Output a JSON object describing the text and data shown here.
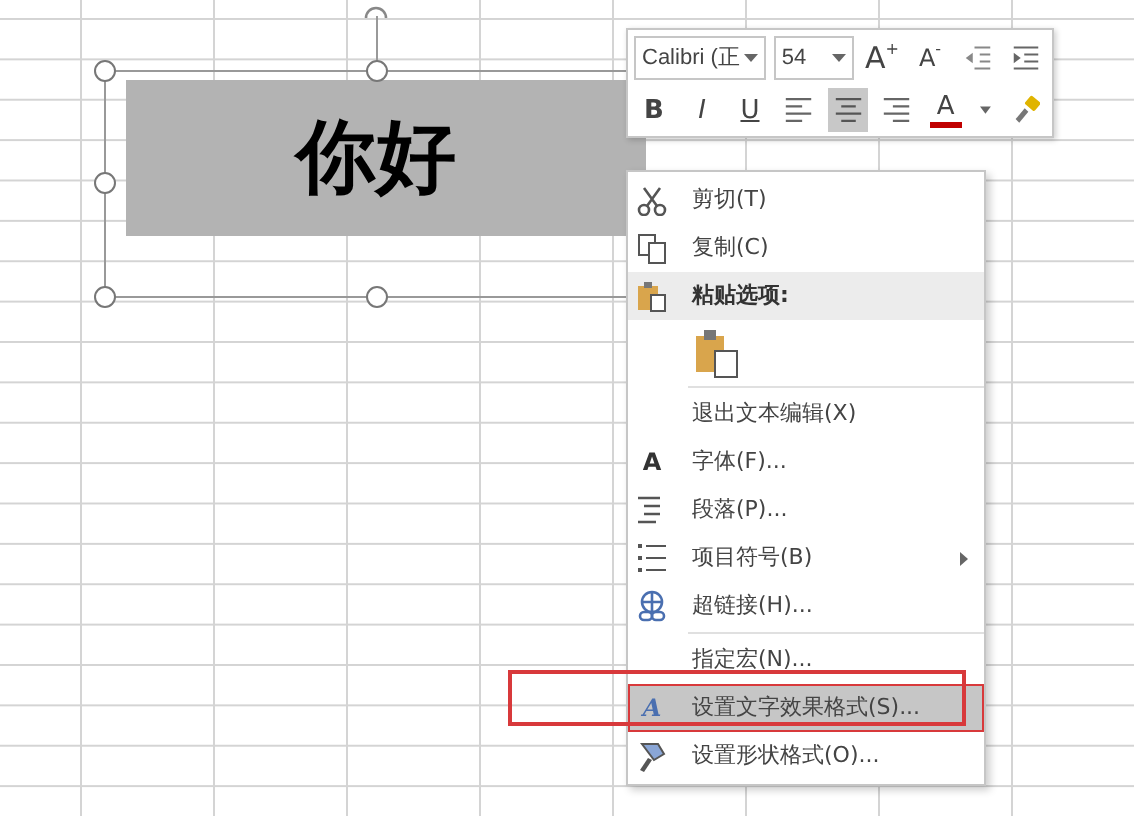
{
  "shape": {
    "text": "你好",
    "selected": true
  },
  "mini_toolbar": {
    "font": "Calibri (正",
    "size": "54",
    "row1": [
      {
        "kind": "text",
        "label": "A",
        "sup": "+"
      },
      {
        "kind": "text",
        "label": "A",
        "sup": "-"
      },
      {
        "kind": "icon"
      },
      {
        "kind": "icon"
      }
    ],
    "row2": [
      {
        "kind": "text",
        "label": "B",
        "selected": false
      },
      {
        "kind": "text",
        "label": "I",
        "selected": false
      },
      {
        "kind": "text",
        "label": "U",
        "selected": false
      },
      {
        "kind": "icon",
        "selected": false
      },
      {
        "kind": "icon",
        "selected": true
      },
      {
        "kind": "icon",
        "selected": false
      },
      {
        "kind": "color",
        "label": "A",
        "color": "#c00000",
        "selected": false
      },
      {
        "kind": "icon",
        "selected": false
      }
    ]
  },
  "context_menu": [
    {
      "kind": "item",
      "label": "剪切(T)",
      "selected": false,
      "submenu": false,
      "annotated": false
    },
    {
      "kind": "item",
      "label": "复制(C)",
      "selected": false,
      "submenu": false,
      "annotated": false
    },
    {
      "kind": "header",
      "label": "粘贴选项:"
    },
    {
      "kind": "paste"
    },
    {
      "kind": "separator"
    },
    {
      "kind": "item",
      "label": "退出文本编辑(X)",
      "selected": false,
      "submenu": false,
      "annotated": false
    },
    {
      "kind": "item",
      "label": "字体(F)...",
      "glyph": "A",
      "selected": false,
      "submenu": false,
      "annotated": false
    },
    {
      "kind": "item",
      "label": "段落(P)...",
      "selected": false,
      "submenu": false,
      "annotated": false
    },
    {
      "kind": "item",
      "label": "项目符号(B)",
      "selected": false,
      "submenu": true,
      "annotated": false
    },
    {
      "kind": "item",
      "label": "超链接(H)...",
      "selected": false,
      "submenu": false,
      "annotated": false
    },
    {
      "kind": "separator"
    },
    {
      "kind": "item",
      "label": "指定宏(N)...",
      "selected": false,
      "submenu": false,
      "annotated": false
    },
    {
      "kind": "item",
      "label": "设置文字效果格式(S)...",
      "glyph": "A",
      "selected": true,
      "submenu": false,
      "annotated": true
    },
    {
      "kind": "item",
      "label": "设置形状格式(O)...",
      "selected": false,
      "submenu": false,
      "annotated": false
    }
  ]
}
